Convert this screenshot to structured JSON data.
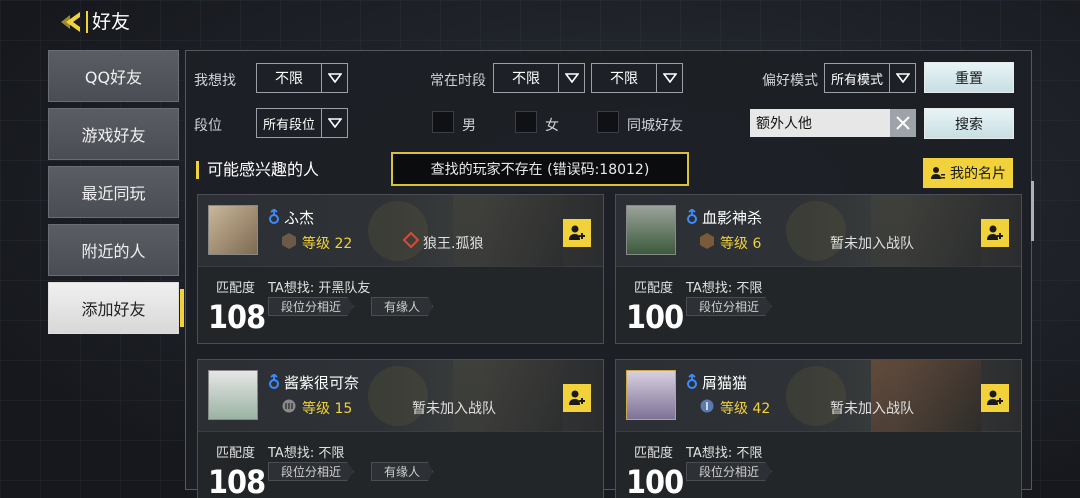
{
  "header": {
    "title": "好友"
  },
  "sidebar": {
    "items": [
      {
        "label": "QQ好友"
      },
      {
        "label": "游戏好友"
      },
      {
        "label": "最近同玩"
      },
      {
        "label": "附近的人"
      },
      {
        "label": "添加好友"
      }
    ],
    "active": 4
  },
  "filters": {
    "seek_label": "我想找",
    "seek_value": "不限",
    "time_label": "常在时段",
    "time_from": "不限",
    "time_to": "不限",
    "mode_label": "偏好模式",
    "mode_value": "所有模式",
    "reset_label": "重置",
    "rank_label": "段位",
    "rank_value": "所有段位",
    "male_label": "男",
    "female_label": "女",
    "local_label": "同城好友",
    "search_value": "额外人他",
    "search_label": "搜索"
  },
  "section_title": "可能感兴趣的人",
  "toast": "查找的玩家不存在 (错误码:18012)",
  "my_card_label": "我的名片",
  "cards": [
    {
      "name": "ふ杰",
      "level": "等级 22",
      "team": "狼王.孤狼",
      "match_label": "匹配度",
      "match": "108",
      "seek": "TA想找: 开黑队友",
      "tag1": "段位分相近",
      "tag2": "有缘人"
    },
    {
      "name": "血影神杀",
      "level": "等级 6",
      "team": "暂未加入战队",
      "match_label": "匹配度",
      "match": "100",
      "seek": "TA想找: 不限",
      "tag1": "段位分相近",
      "tag2": ""
    },
    {
      "name": "酱紫很可奈",
      "level": "等级 15",
      "team": "暂未加入战队",
      "match_label": "匹配度",
      "match": "108",
      "seek": "TA想找: 不限",
      "tag1": "段位分相近",
      "tag2": "有缘人"
    },
    {
      "name": "屑猫猫",
      "level": "等级 42",
      "team": "暂未加入战队",
      "match_label": "匹配度",
      "match": "100",
      "seek": "TA想找: 不限",
      "tag1": "段位分相近",
      "tag2": ""
    }
  ],
  "colors": {
    "accent": "#f2d23b",
    "gender": "#3d8cff"
  }
}
